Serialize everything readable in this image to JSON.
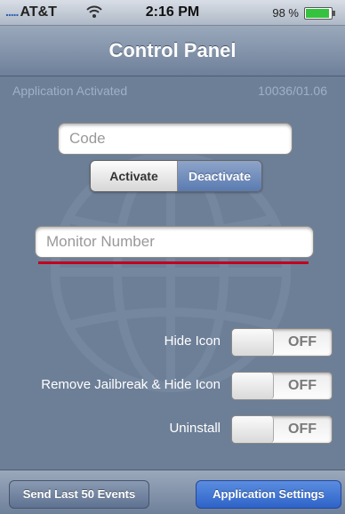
{
  "status_bar": {
    "carrier": "AT&T",
    "time": "2:16 PM",
    "battery_percent": "98 %"
  },
  "nav": {
    "title": "Control Panel"
  },
  "info": {
    "status": "Application Activated",
    "version": "10036/01.06"
  },
  "code_input": {
    "placeholder": "Code",
    "value": ""
  },
  "segment": {
    "activate": "Activate",
    "deactivate": "Deactivate",
    "selected": "Deactivate"
  },
  "monitor_input": {
    "placeholder": "Monitor Number",
    "value": ""
  },
  "toggles": [
    {
      "label": "Hide Icon",
      "state": "OFF"
    },
    {
      "label": "Remove Jailbreak & Hide Icon",
      "state": "OFF"
    },
    {
      "label": "Uninstall",
      "state": "OFF"
    }
  ],
  "bottom": {
    "send_events": "Send Last 50 Events",
    "settings": "Application Settings"
  },
  "colors": {
    "background": "#6d7f97",
    "accent": "#2e63c8",
    "warning_line": "#c0001e"
  }
}
